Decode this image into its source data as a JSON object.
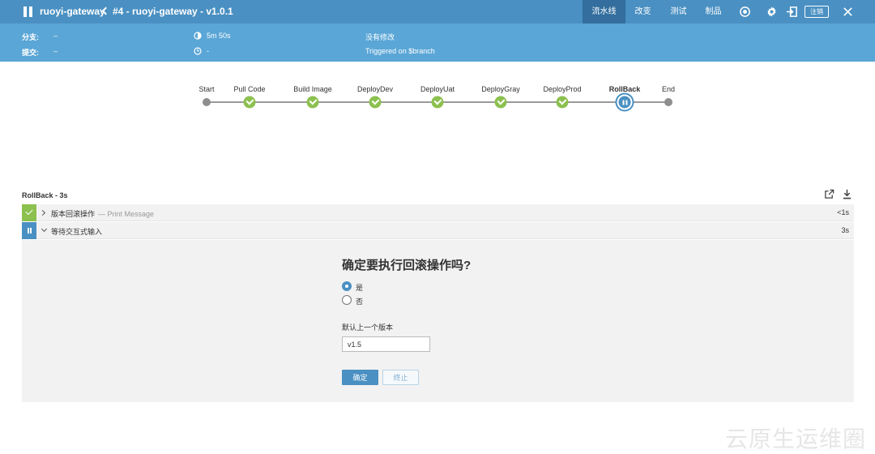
{
  "header": {
    "job_name": "ruoyi-gateway",
    "run_title": "#4 - ruoyi-gateway - v1.0.1",
    "tabs": [
      {
        "label": "流水线",
        "active": true
      },
      {
        "label": "改变",
        "active": false
      },
      {
        "label": "测试",
        "active": false
      },
      {
        "label": "制品",
        "active": false
      }
    ],
    "icons": [
      "replay-icon",
      "gear-icon",
      "exit-icon",
      "close-icon"
    ],
    "logout_label": "注销"
  },
  "summary": {
    "branch_label": "分支:",
    "branch_value": "–",
    "commit_label": "提交:",
    "commit_value": "–",
    "duration": "5m 50s",
    "started": "-",
    "changes": "没有修改",
    "trigger": "Triggered on $branch"
  },
  "pipeline": {
    "stages": [
      {
        "name": "Start",
        "status": "start"
      },
      {
        "name": "Pull Code",
        "status": "success"
      },
      {
        "name": "Build Image",
        "status": "success"
      },
      {
        "name": "DeployDev",
        "status": "success"
      },
      {
        "name": "DeployUat",
        "status": "success"
      },
      {
        "name": "DeployGray",
        "status": "success"
      },
      {
        "name": "DeployProd",
        "status": "success"
      },
      {
        "name": "RollBack",
        "status": "paused"
      },
      {
        "name": "End",
        "status": "end"
      }
    ]
  },
  "step": {
    "title": "RollBack - 3s",
    "rows": [
      {
        "label": "版本回滚操作",
        "sub": "— Print Message",
        "duration": "<1s",
        "status": "success"
      },
      {
        "label": "等待交互式输入",
        "sub": "",
        "duration": "3s",
        "status": "paused"
      }
    ]
  },
  "input": {
    "question": "确定要执行回滚操作吗?",
    "options": [
      {
        "label": "是",
        "checked": true
      },
      {
        "label": "否",
        "checked": false
      }
    ],
    "field_label": "默认上一个版本",
    "field_value": "v1.5",
    "proceed_label": "确定",
    "abort_label": "终止"
  },
  "watermark": "云原生运维圈",
  "colors": {
    "header": "#4a90c2",
    "subheader": "#5aa6d6",
    "success": "#8cc04f",
    "paused": "#4a90c2"
  }
}
